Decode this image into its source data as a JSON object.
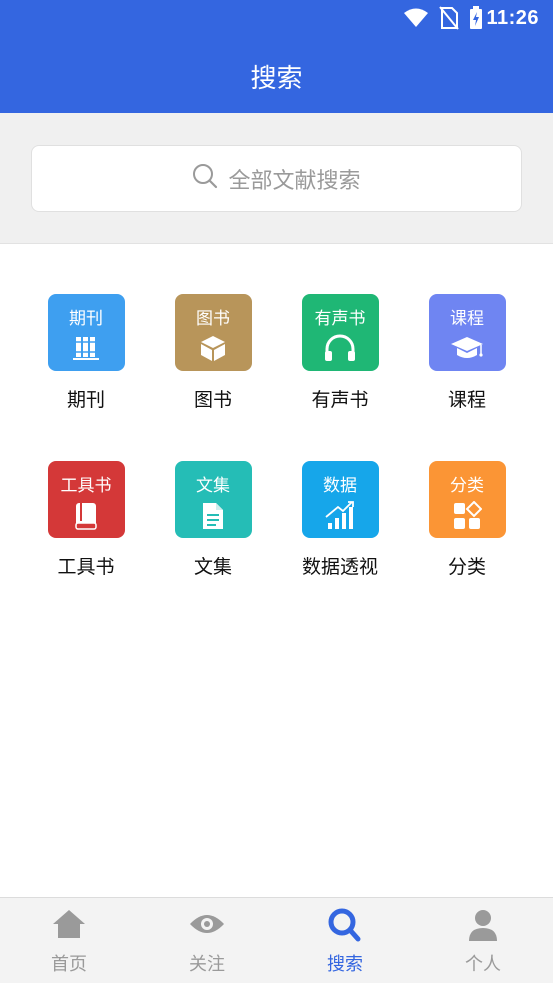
{
  "status_bar": {
    "time": "11:26"
  },
  "header": {
    "title": "搜索"
  },
  "search": {
    "placeholder": "全部文献搜索"
  },
  "colors": {
    "primary": "#3466e0"
  },
  "tiles": [
    {
      "icon_text": "期刊",
      "label": "期刊",
      "color": "#3e9ff0",
      "icon": "books-icon"
    },
    {
      "icon_text": "图书",
      "label": "图书",
      "color": "#b8955a",
      "icon": "box-icon"
    },
    {
      "icon_text": "有声书",
      "label": "有声书",
      "color": "#1fb775",
      "icon": "headphones-icon"
    },
    {
      "icon_text": "课程",
      "label": "课程",
      "color": "#6f85f2",
      "icon": "graduation-cap-icon"
    },
    {
      "icon_text": "工具书",
      "label": "工具书",
      "color": "#d43838",
      "icon": "book-icon"
    },
    {
      "icon_text": "文集",
      "label": "文集",
      "color": "#25bdb6",
      "icon": "document-icon"
    },
    {
      "icon_text": "数据",
      "label": "数据透视",
      "color": "#16a6ea",
      "icon": "chart-icon"
    },
    {
      "icon_text": "分类",
      "label": "分类",
      "color": "#fb9535",
      "icon": "category-icon"
    }
  ],
  "tabs": [
    {
      "label": "首页",
      "icon": "home-icon",
      "active": false
    },
    {
      "label": "关注",
      "icon": "eye-icon",
      "active": false
    },
    {
      "label": "搜索",
      "icon": "search-icon",
      "active": true
    },
    {
      "label": "个人",
      "icon": "person-icon",
      "active": false
    }
  ]
}
